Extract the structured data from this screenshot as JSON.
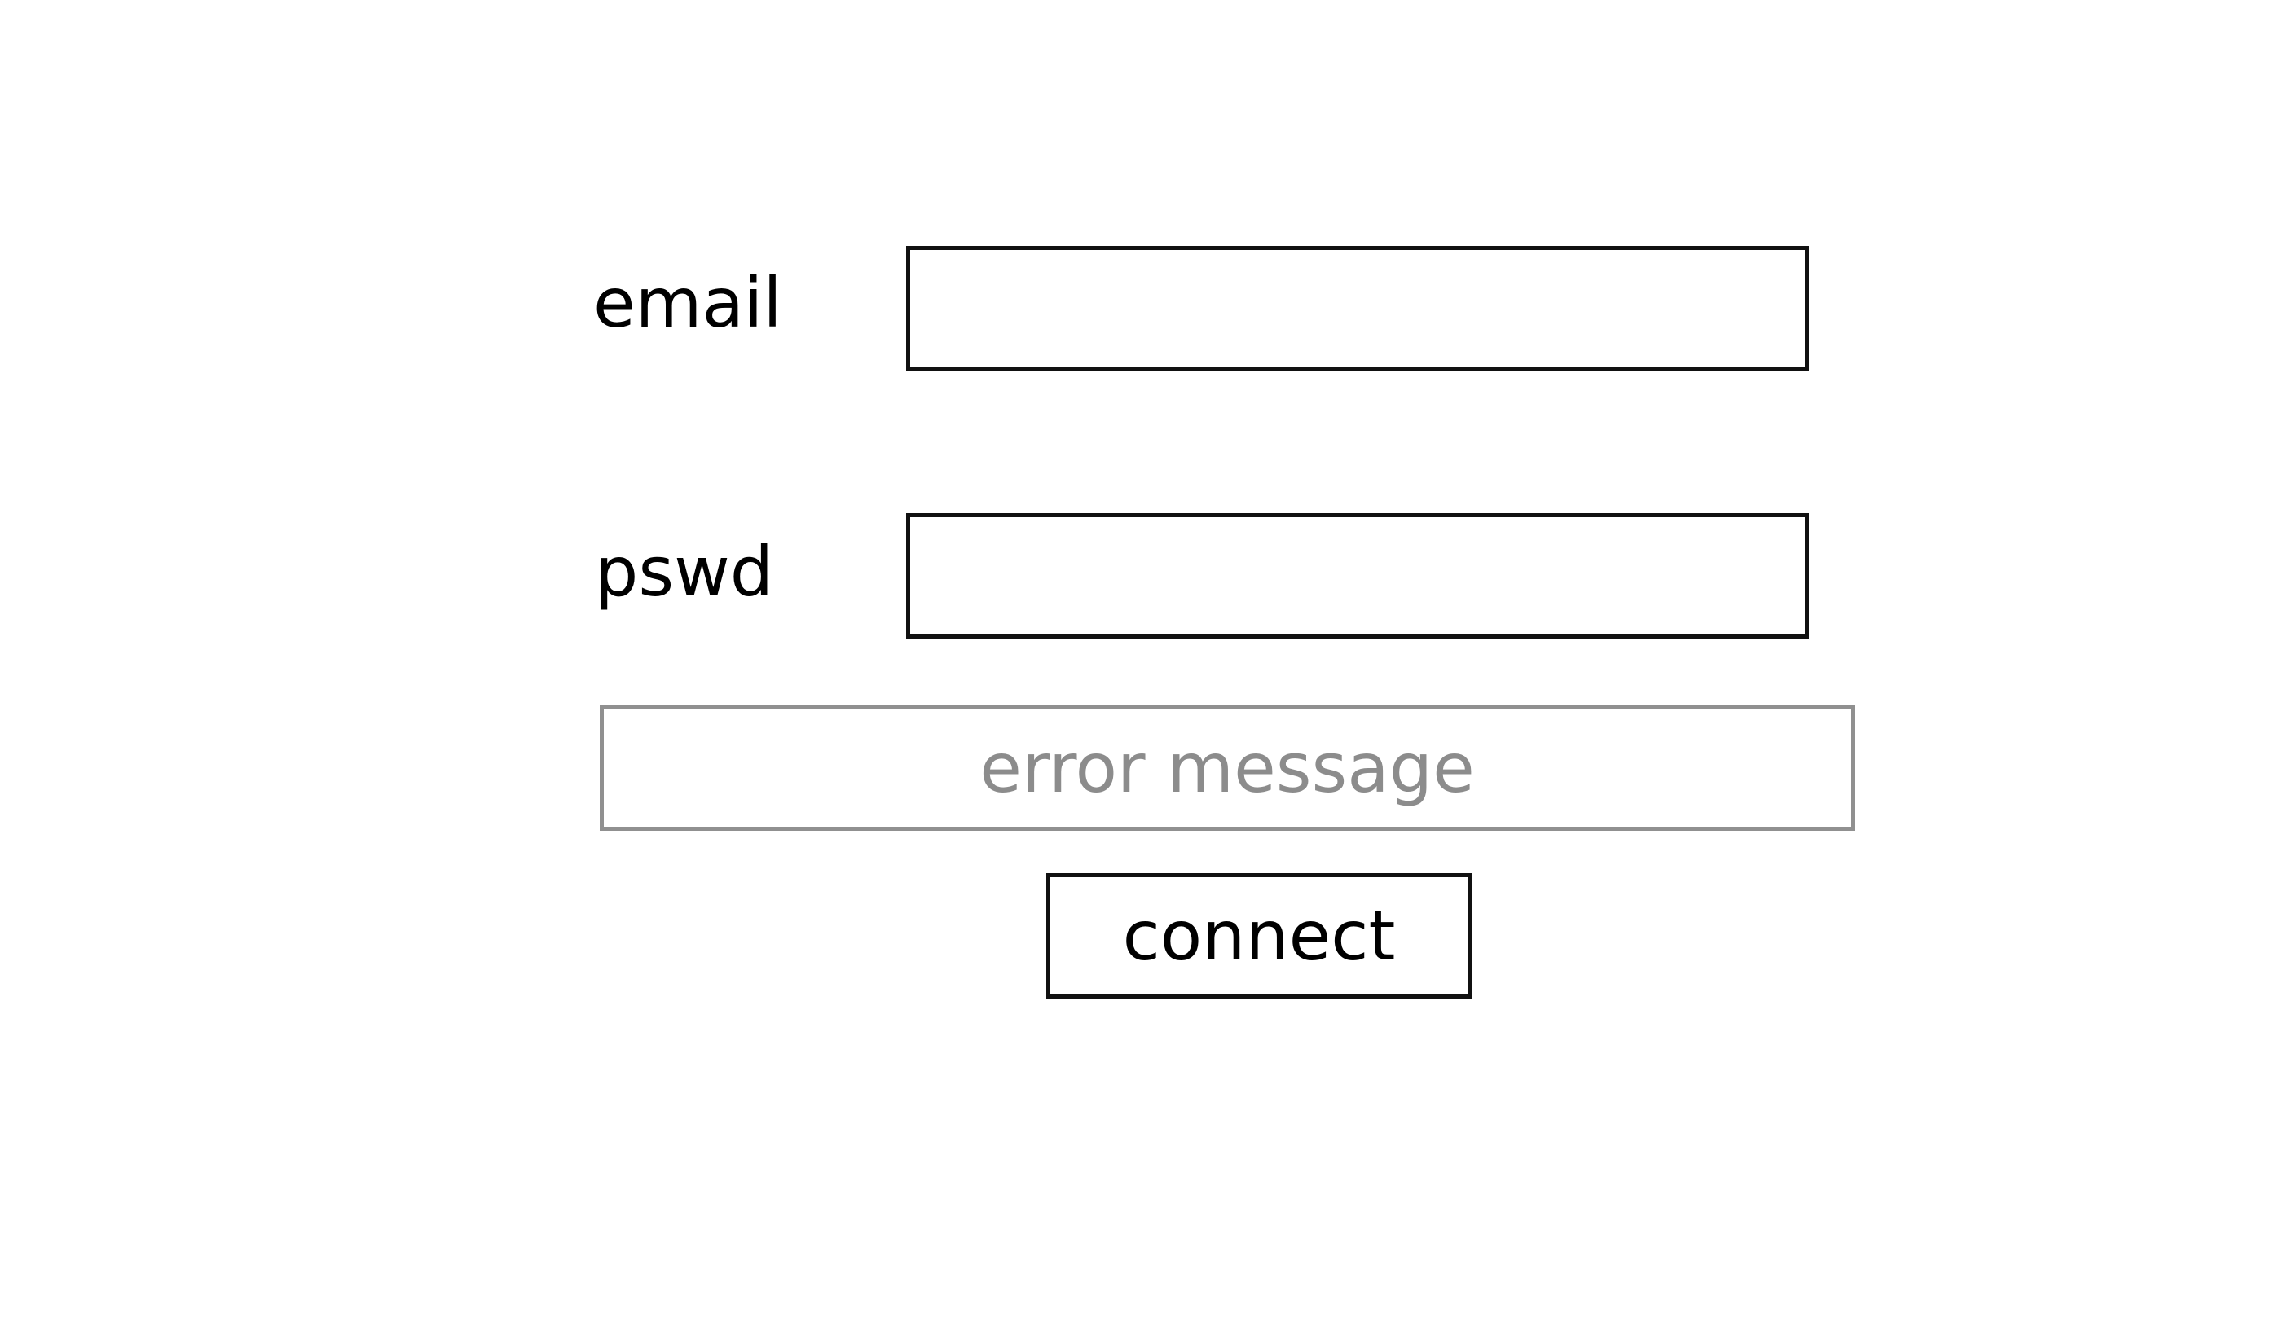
{
  "form": {
    "email_label": "email",
    "email_value": "",
    "pswd_label": "pswd",
    "pswd_value": "",
    "error_message": "error message",
    "connect_label": "connect"
  },
  "colors": {
    "text": "#000000",
    "border": "#111111",
    "error_text": "#8c8c8c",
    "error_border": "#909090",
    "background": "#ffffff"
  }
}
